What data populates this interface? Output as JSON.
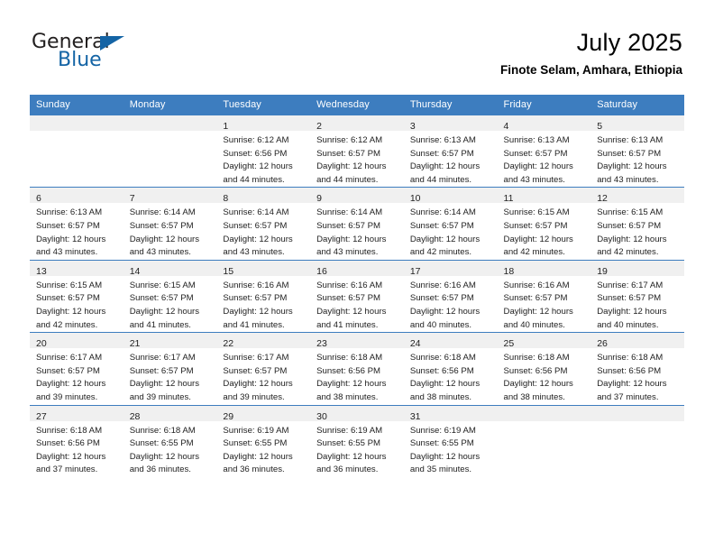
{
  "logo": {
    "word1": "General",
    "word2": "Blue",
    "triangle_color": "#1464a5",
    "icon": "general-blue-logo"
  },
  "header": {
    "month_title": "July 2025",
    "location": "Finote Selam, Amhara, Ethiopia"
  },
  "theme": {
    "header_bg": "#3d7dbf",
    "header_text": "#ffffff",
    "daynum_band_bg": "#f0f0f0",
    "grid_line": "#3d7dbf",
    "body_text": "#222222"
  },
  "weekday_headers": [
    "Sunday",
    "Monday",
    "Tuesday",
    "Wednesday",
    "Thursday",
    "Friday",
    "Saturday"
  ],
  "weeks": [
    [
      {
        "day": "",
        "lines": []
      },
      {
        "day": "",
        "lines": []
      },
      {
        "day": "1",
        "lines": [
          "Sunrise: 6:12 AM",
          "Sunset: 6:56 PM",
          "Daylight: 12 hours",
          "and 44 minutes."
        ]
      },
      {
        "day": "2",
        "lines": [
          "Sunrise: 6:12 AM",
          "Sunset: 6:57 PM",
          "Daylight: 12 hours",
          "and 44 minutes."
        ]
      },
      {
        "day": "3",
        "lines": [
          "Sunrise: 6:13 AM",
          "Sunset: 6:57 PM",
          "Daylight: 12 hours",
          "and 44 minutes."
        ]
      },
      {
        "day": "4",
        "lines": [
          "Sunrise: 6:13 AM",
          "Sunset: 6:57 PM",
          "Daylight: 12 hours",
          "and 43 minutes."
        ]
      },
      {
        "day": "5",
        "lines": [
          "Sunrise: 6:13 AM",
          "Sunset: 6:57 PM",
          "Daylight: 12 hours",
          "and 43 minutes."
        ]
      }
    ],
    [
      {
        "day": "6",
        "lines": [
          "Sunrise: 6:13 AM",
          "Sunset: 6:57 PM",
          "Daylight: 12 hours",
          "and 43 minutes."
        ]
      },
      {
        "day": "7",
        "lines": [
          "Sunrise: 6:14 AM",
          "Sunset: 6:57 PM",
          "Daylight: 12 hours",
          "and 43 minutes."
        ]
      },
      {
        "day": "8",
        "lines": [
          "Sunrise: 6:14 AM",
          "Sunset: 6:57 PM",
          "Daylight: 12 hours",
          "and 43 minutes."
        ]
      },
      {
        "day": "9",
        "lines": [
          "Sunrise: 6:14 AM",
          "Sunset: 6:57 PM",
          "Daylight: 12 hours",
          "and 43 minutes."
        ]
      },
      {
        "day": "10",
        "lines": [
          "Sunrise: 6:14 AM",
          "Sunset: 6:57 PM",
          "Daylight: 12 hours",
          "and 42 minutes."
        ]
      },
      {
        "day": "11",
        "lines": [
          "Sunrise: 6:15 AM",
          "Sunset: 6:57 PM",
          "Daylight: 12 hours",
          "and 42 minutes."
        ]
      },
      {
        "day": "12",
        "lines": [
          "Sunrise: 6:15 AM",
          "Sunset: 6:57 PM",
          "Daylight: 12 hours",
          "and 42 minutes."
        ]
      }
    ],
    [
      {
        "day": "13",
        "lines": [
          "Sunrise: 6:15 AM",
          "Sunset: 6:57 PM",
          "Daylight: 12 hours",
          "and 42 minutes."
        ]
      },
      {
        "day": "14",
        "lines": [
          "Sunrise: 6:15 AM",
          "Sunset: 6:57 PM",
          "Daylight: 12 hours",
          "and 41 minutes."
        ]
      },
      {
        "day": "15",
        "lines": [
          "Sunrise: 6:16 AM",
          "Sunset: 6:57 PM",
          "Daylight: 12 hours",
          "and 41 minutes."
        ]
      },
      {
        "day": "16",
        "lines": [
          "Sunrise: 6:16 AM",
          "Sunset: 6:57 PM",
          "Daylight: 12 hours",
          "and 41 minutes."
        ]
      },
      {
        "day": "17",
        "lines": [
          "Sunrise: 6:16 AM",
          "Sunset: 6:57 PM",
          "Daylight: 12 hours",
          "and 40 minutes."
        ]
      },
      {
        "day": "18",
        "lines": [
          "Sunrise: 6:16 AM",
          "Sunset: 6:57 PM",
          "Daylight: 12 hours",
          "and 40 minutes."
        ]
      },
      {
        "day": "19",
        "lines": [
          "Sunrise: 6:17 AM",
          "Sunset: 6:57 PM",
          "Daylight: 12 hours",
          "and 40 minutes."
        ]
      }
    ],
    [
      {
        "day": "20",
        "lines": [
          "Sunrise: 6:17 AM",
          "Sunset: 6:57 PM",
          "Daylight: 12 hours",
          "and 39 minutes."
        ]
      },
      {
        "day": "21",
        "lines": [
          "Sunrise: 6:17 AM",
          "Sunset: 6:57 PM",
          "Daylight: 12 hours",
          "and 39 minutes."
        ]
      },
      {
        "day": "22",
        "lines": [
          "Sunrise: 6:17 AM",
          "Sunset: 6:57 PM",
          "Daylight: 12 hours",
          "and 39 minutes."
        ]
      },
      {
        "day": "23",
        "lines": [
          "Sunrise: 6:18 AM",
          "Sunset: 6:56 PM",
          "Daylight: 12 hours",
          "and 38 minutes."
        ]
      },
      {
        "day": "24",
        "lines": [
          "Sunrise: 6:18 AM",
          "Sunset: 6:56 PM",
          "Daylight: 12 hours",
          "and 38 minutes."
        ]
      },
      {
        "day": "25",
        "lines": [
          "Sunrise: 6:18 AM",
          "Sunset: 6:56 PM",
          "Daylight: 12 hours",
          "and 38 minutes."
        ]
      },
      {
        "day": "26",
        "lines": [
          "Sunrise: 6:18 AM",
          "Sunset: 6:56 PM",
          "Daylight: 12 hours",
          "and 37 minutes."
        ]
      }
    ],
    [
      {
        "day": "27",
        "lines": [
          "Sunrise: 6:18 AM",
          "Sunset: 6:56 PM",
          "Daylight: 12 hours",
          "and 37 minutes."
        ]
      },
      {
        "day": "28",
        "lines": [
          "Sunrise: 6:18 AM",
          "Sunset: 6:55 PM",
          "Daylight: 12 hours",
          "and 36 minutes."
        ]
      },
      {
        "day": "29",
        "lines": [
          "Sunrise: 6:19 AM",
          "Sunset: 6:55 PM",
          "Daylight: 12 hours",
          "and 36 minutes."
        ]
      },
      {
        "day": "30",
        "lines": [
          "Sunrise: 6:19 AM",
          "Sunset: 6:55 PM",
          "Daylight: 12 hours",
          "and 36 minutes."
        ]
      },
      {
        "day": "31",
        "lines": [
          "Sunrise: 6:19 AM",
          "Sunset: 6:55 PM",
          "Daylight: 12 hours",
          "and 35 minutes."
        ]
      },
      {
        "day": "",
        "lines": []
      },
      {
        "day": "",
        "lines": []
      }
    ]
  ]
}
